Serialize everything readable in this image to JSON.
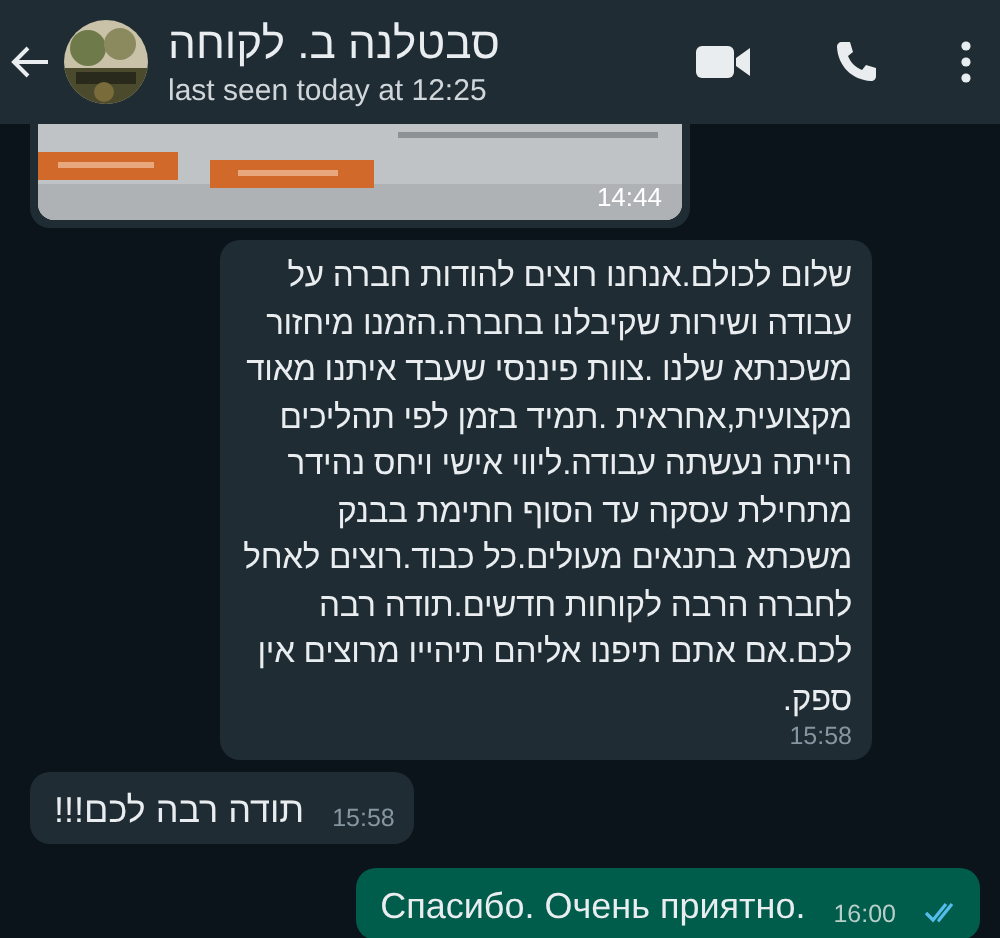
{
  "header": {
    "name": "סבטלנה ב. לקוחה",
    "status": "last seen today at 12:25"
  },
  "messages": [
    {
      "outgoing": false,
      "time": "14:44"
    },
    {
      "kind": "long_text",
      "outgoing": false,
      "text": "שלום לכולם.אנחנו רוצים להודות חברה על עבודה ושירות שקיבלנו בחברה.הזמנו מיחזור משכנתא שלנו .צוות פיננסי שעבד איתנו מאוד מקצועית,אחראית .תמיד בזמן לפי תהליכים הייתה נעשתה עבודה.ליווי אישי ויחס נהידר מתחילת עסקה עד הסוף חתימת בבנק משכתא בתנאים מעולים.כל כבוד.רוצים לאחל לחברה הרבה לקוחות חדשים.תודה רבה לכם.אם אתם תיפנו אליהם תיהייו מרוצים אין ספק.",
      "time": "15:58"
    },
    {
      "kind": "text",
      "outgoing": false,
      "text": "תודה רבה לכם!!!",
      "time": "15:58"
    },
    {
      "kind": "text",
      "outgoing": true,
      "text": "Спасибо. Очень приятно.",
      "time": "16:00",
      "read": true
    }
  ]
}
